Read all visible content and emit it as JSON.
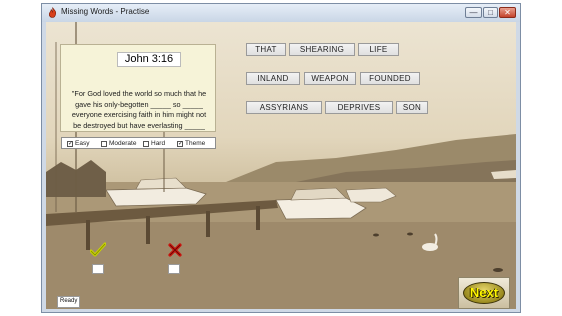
{
  "window": {
    "title": "Missing Words - Practise",
    "app_icon": "flame-icon",
    "minimize_label": "—",
    "maximize_label": "□",
    "close_label": "✕"
  },
  "verse": {
    "reference": "John 3:16",
    "text": "\"For God loved the world so much that he gave his only-begotten _____ so _____ everyone exercising faith in him might not be destroyed but have everlasting _____"
  },
  "levels": [
    {
      "label": "Easy",
      "checked": true
    },
    {
      "label": "Moderate",
      "checked": false
    },
    {
      "label": "Hard",
      "checked": false
    },
    {
      "label": "Theme",
      "checked": true
    }
  ],
  "word_rows": [
    [
      "THAT",
      "SHEARING",
      "LIFE"
    ],
    [
      "INLAND",
      "WEAPON",
      "FOUNDED"
    ],
    [
      "ASSYRIANS",
      "DEPRIVES",
      "SON"
    ]
  ],
  "score_marks": [
    {
      "icon": "check-mark-icon",
      "meaning": "correct",
      "color": "#c8d400"
    },
    {
      "icon": "cross-mark-icon",
      "meaning": "wrong",
      "color": "#c8140e"
    }
  ],
  "status": "Ready",
  "next_label": "Next",
  "colors": {
    "accent_next": "#fff700",
    "verse_bg": "#f6f3d8"
  }
}
